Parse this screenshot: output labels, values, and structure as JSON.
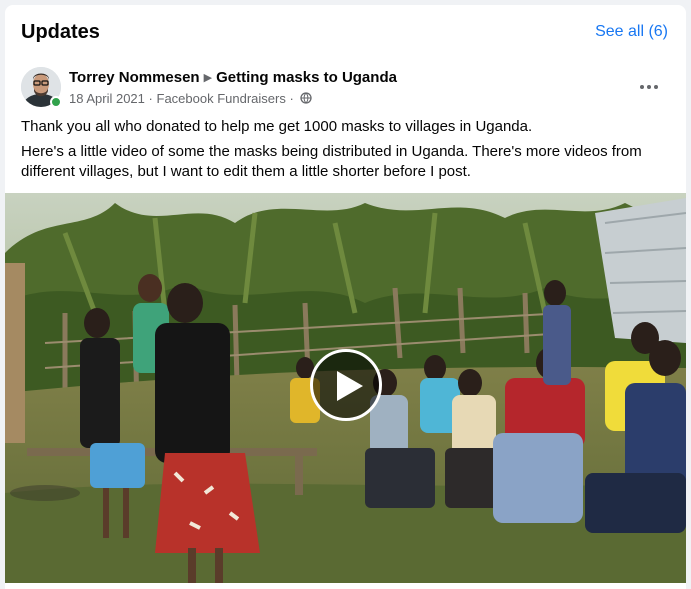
{
  "header": {
    "title": "Updates",
    "see_all_label": "See all (6)"
  },
  "post": {
    "author": "Torrey Nommesen",
    "target": "Getting masks to Uganda",
    "date": "18 April 2021",
    "source": "Facebook Fundraisers",
    "separator": "·",
    "paragraphs": [
      "Thank you all who donated to help me get 1000 masks to villages in Uganda.",
      "Here's a little video of some the masks being distributed in Uganda. There's more videos from different villages, but I want to edit them a little shorter before I post."
    ]
  },
  "colors": {
    "accent": "#1877f2",
    "online": "#31a24c",
    "secondary_text": "#65676b"
  },
  "icons": {
    "more": "more-options-icon",
    "privacy": "globe-icon",
    "play": "play-icon"
  }
}
